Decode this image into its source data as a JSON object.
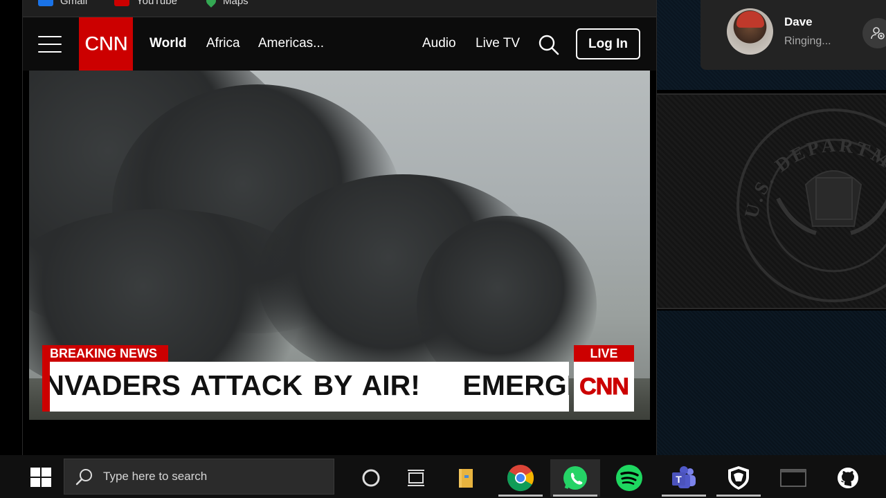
{
  "bookmarks": [
    {
      "label": "Gmail",
      "icon": "gmail-icon",
      "color": "#1a73e8"
    },
    {
      "label": "YouTube",
      "icon": "youtube-icon",
      "color": "#cc0000"
    },
    {
      "label": "Maps",
      "icon": "maps-icon",
      "color": "#34a853"
    }
  ],
  "cnn": {
    "logo_text": "CNN",
    "nav": {
      "world": "World",
      "africa": "Africa",
      "americas": "Americas...",
      "audio": "Audio",
      "live_tv": "Live TV"
    },
    "login_label": "Log In",
    "accent": "#cc0000"
  },
  "video": {
    "breaking_label": "BREAKING NEWS",
    "ticker_text": "INVADERS ATTACK BY AIR!    EMERGENCY",
    "live_label": "LIVE",
    "live_logo": "CNN"
  },
  "call": {
    "name": "Dave",
    "status": "Ringing..."
  },
  "seal_text": "U.S. DEPARTMENT OF HOMELAND SECURITY",
  "taskbar": {
    "search_placeholder": "Type here to search",
    "apps": [
      {
        "name": "cortana",
        "icon": "cortana-icon"
      },
      {
        "name": "task-view",
        "icon": "task-view-icon"
      },
      {
        "name": "file-explorer",
        "icon": "folder-icon"
      },
      {
        "name": "chrome",
        "icon": "chrome-icon"
      },
      {
        "name": "whatsapp",
        "icon": "whatsapp-icon"
      },
      {
        "name": "spotify",
        "icon": "spotify-icon"
      },
      {
        "name": "teams",
        "icon": "teams-icon"
      },
      {
        "name": "guardian",
        "icon": "guardian-icon"
      },
      {
        "name": "terminal",
        "icon": "terminal-icon"
      },
      {
        "name": "github",
        "icon": "github-icon"
      }
    ]
  }
}
